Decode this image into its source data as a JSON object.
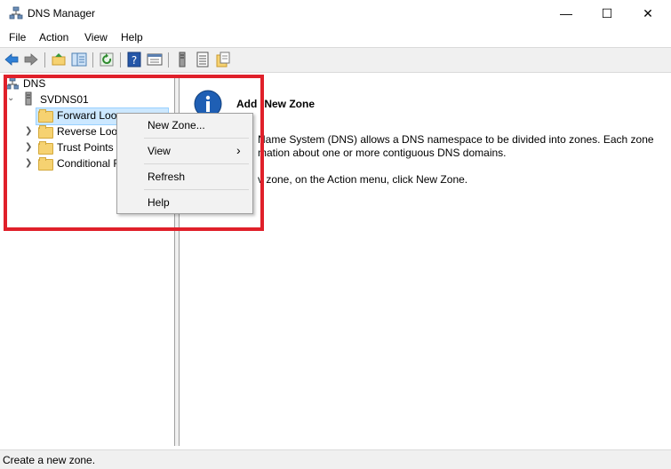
{
  "window": {
    "title": "DNS Manager"
  },
  "caption_buttons": {
    "minimize": "—",
    "maximize": "☐",
    "close": "✕"
  },
  "menubar": {
    "items": [
      "File",
      "Action",
      "View",
      "Help"
    ]
  },
  "toolbar": {
    "icons": [
      "back-arrow-icon",
      "forward-arrow-icon",
      "up-folder-icon",
      "show-hide-tree-icon",
      "refresh-icon",
      "help-icon",
      "properties-icon",
      "server-icon",
      "list-icon",
      "export-icon"
    ]
  },
  "tree": {
    "root": "DNS",
    "server": "SVDNS01",
    "children": [
      "Forward Loo",
      "Reverse Look",
      "Trust Points",
      "Conditional F"
    ],
    "expand_chevron": "❯",
    "collapse_chevron": "⌄"
  },
  "context_menu": {
    "items": [
      {
        "label": "New Zone...",
        "underline_char": "Z"
      },
      {
        "label": "View",
        "submenu_arrow": "›"
      },
      {
        "label": "Refresh"
      },
      {
        "label": "Help"
      }
    ]
  },
  "details": {
    "heading_visible": "Add",
    "heading_rest": "New Zone",
    "line1": "Name System (DNS) allows a DNS namespace to be divided into zones. Each zone",
    "line2": "mation about one or more contiguous DNS domains.",
    "line3": "v zone, on the Action menu, click New Zone."
  },
  "status": {
    "text": "Create a new zone."
  },
  "colors": {
    "highlight": "#e0202a",
    "info_icon": "#1f5fb4"
  }
}
